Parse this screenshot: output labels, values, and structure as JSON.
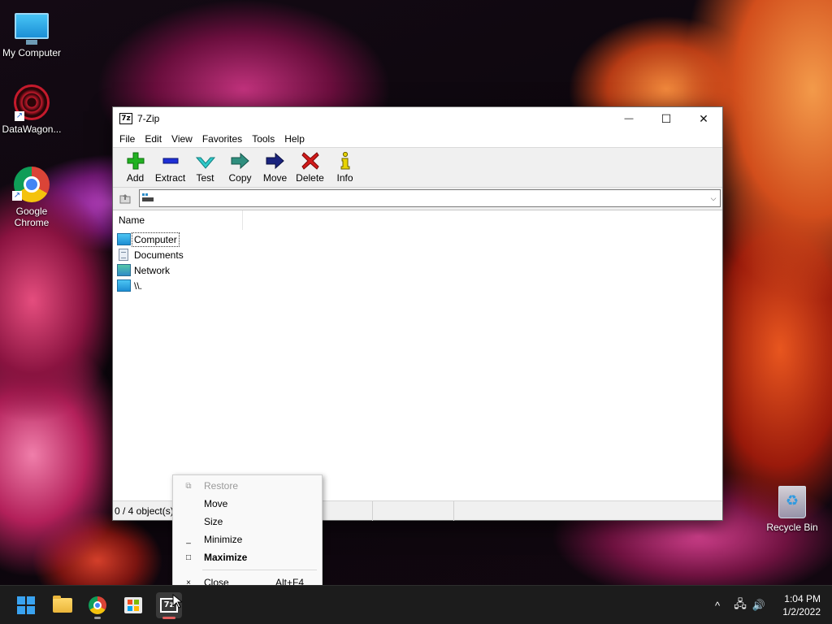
{
  "desktop": {
    "icons": [
      {
        "label": "My Computer"
      },
      {
        "label": "DataWagon..."
      },
      {
        "label": "Google Chrome"
      },
      {
        "label": "Recycle Bin"
      }
    ]
  },
  "window": {
    "title": "7-Zip",
    "app_icon_text": "7z",
    "controls": {
      "minimize": "—",
      "maximize": "☐",
      "close": "✕"
    },
    "menu": [
      "File",
      "Edit",
      "View",
      "Favorites",
      "Tools",
      "Help"
    ],
    "toolbar": [
      {
        "label": "Add",
        "icon": "plus-icon",
        "color": "#22b222"
      },
      {
        "label": "Extract",
        "icon": "minus-icon",
        "color": "#1e2fd6"
      },
      {
        "label": "Test",
        "icon": "check-icon",
        "color": "#2fc9c9"
      },
      {
        "label": "Copy",
        "icon": "arrow-right-icon",
        "color": "#2f8f7f"
      },
      {
        "label": "Move",
        "icon": "arrow-right-icon",
        "color": "#1a237e"
      },
      {
        "label": "Delete",
        "icon": "x-icon",
        "color": "#d21a1a"
      },
      {
        "label": "Info",
        "icon": "info-icon",
        "color": "#e8d400"
      }
    ],
    "address": {
      "value": ""
    },
    "file_list": {
      "columns": [
        "Name"
      ],
      "rows": [
        {
          "name": "Computer",
          "icon": "computer-icon"
        },
        {
          "name": "Documents",
          "icon": "documents-icon"
        },
        {
          "name": "Network",
          "icon": "network-icon"
        },
        {
          "name": "\\\\.",
          "icon": "computer-icon"
        }
      ]
    },
    "status": {
      "objects": "0 / 4 object(s)"
    }
  },
  "context_menu": {
    "items": [
      {
        "label": "Restore",
        "glyph": "⧉",
        "disabled": true
      },
      {
        "label": "Move"
      },
      {
        "label": "Size"
      },
      {
        "label": "Minimize",
        "glyph": "_"
      },
      {
        "label": "Maximize",
        "glyph": "□",
        "bold": true
      },
      {
        "label": "Close",
        "glyph": "×",
        "shortcut": "Alt+F4"
      }
    ]
  },
  "taskbar": {
    "clock": {
      "time": "1:04 PM",
      "date": "1/2/2022"
    },
    "zip_icon_text": "7z",
    "tray": {
      "chevron": "^",
      "network": "🖧",
      "volume": "🔊"
    }
  },
  "colors": {
    "accent": "#3aa3f0",
    "active_indicator": "#e25d5d"
  }
}
